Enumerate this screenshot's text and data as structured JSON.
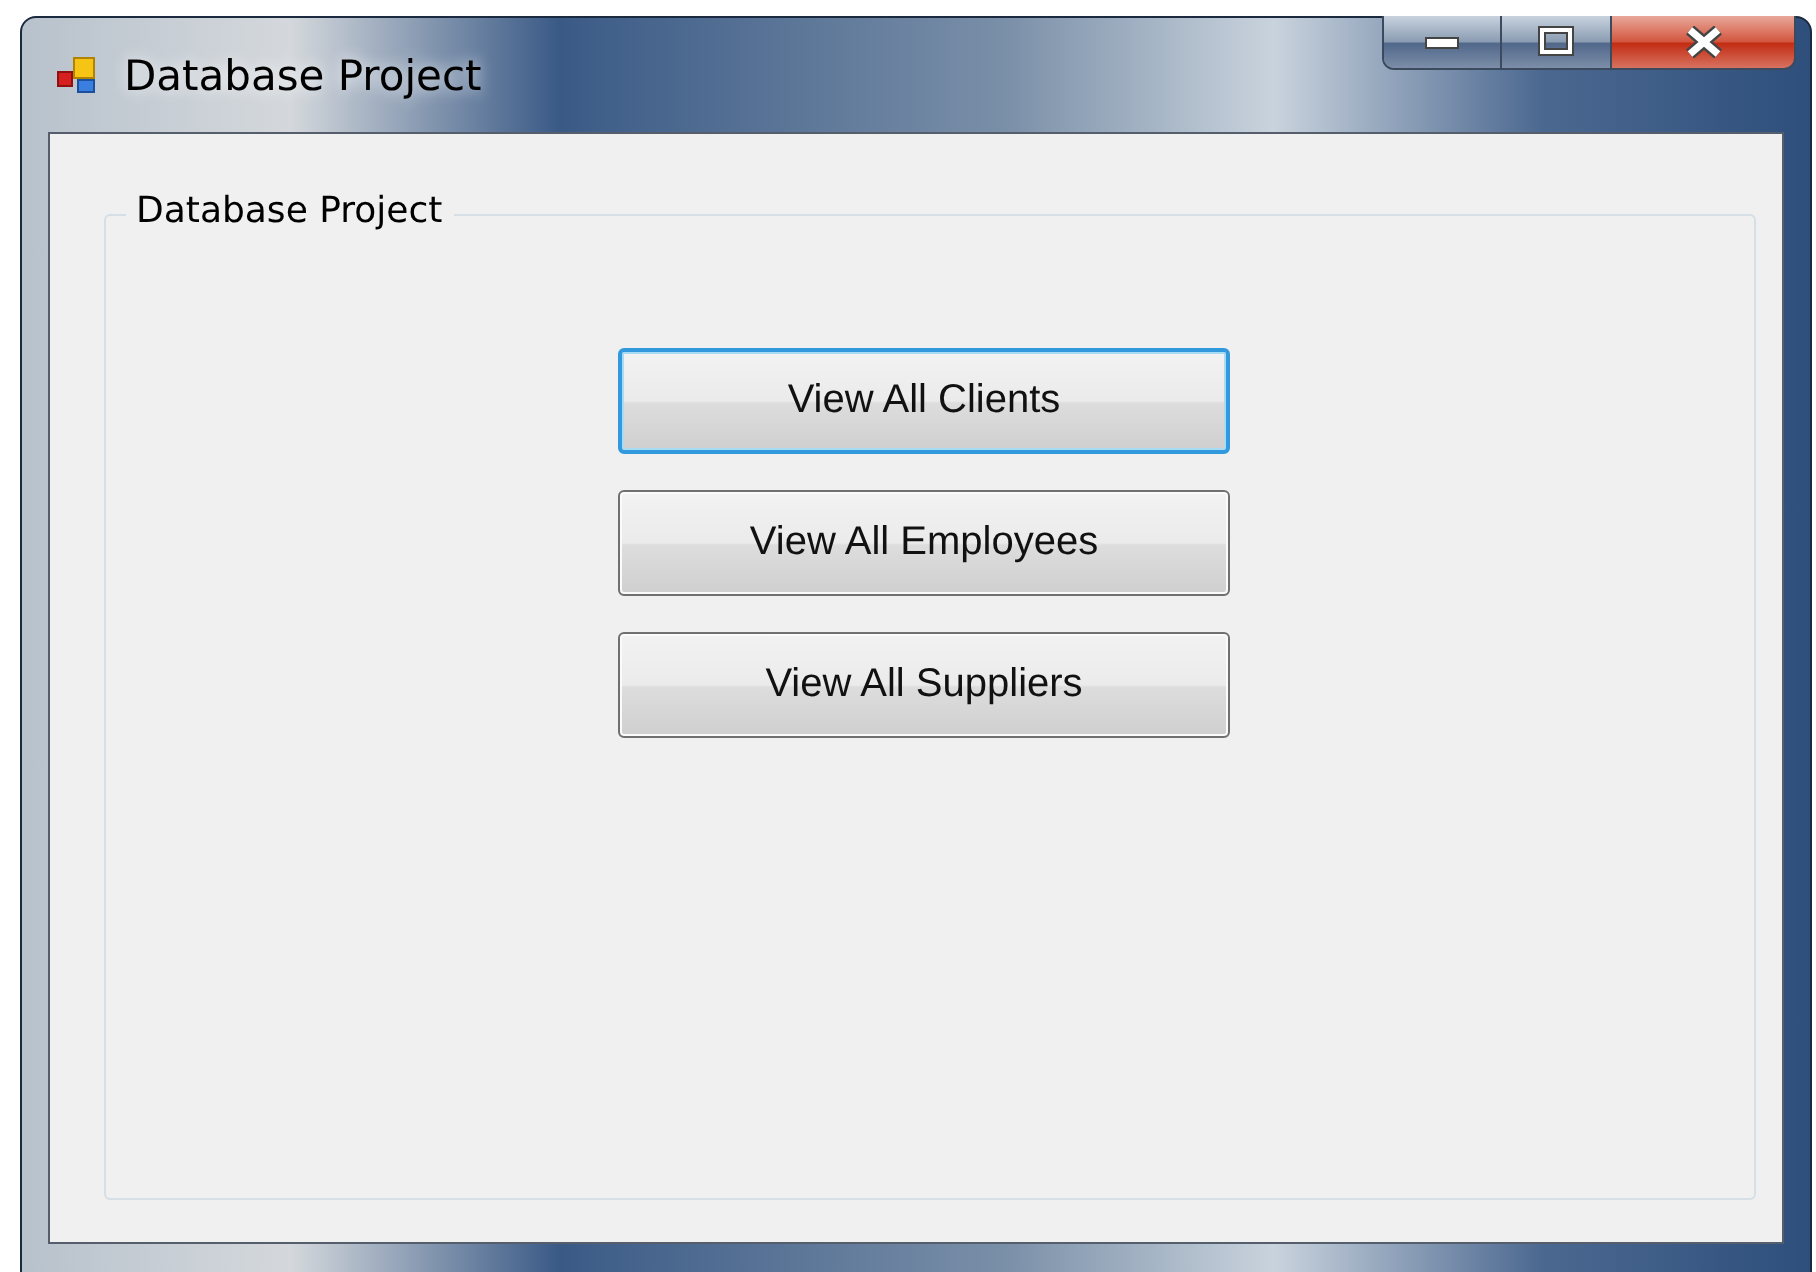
{
  "window": {
    "title": "Database Project"
  },
  "group": {
    "label": "Database Project"
  },
  "buttons": [
    {
      "label": "View All Clients",
      "focused": true
    },
    {
      "label": "View All Employees",
      "focused": false
    },
    {
      "label": "View All Suppliers",
      "focused": false
    }
  ]
}
